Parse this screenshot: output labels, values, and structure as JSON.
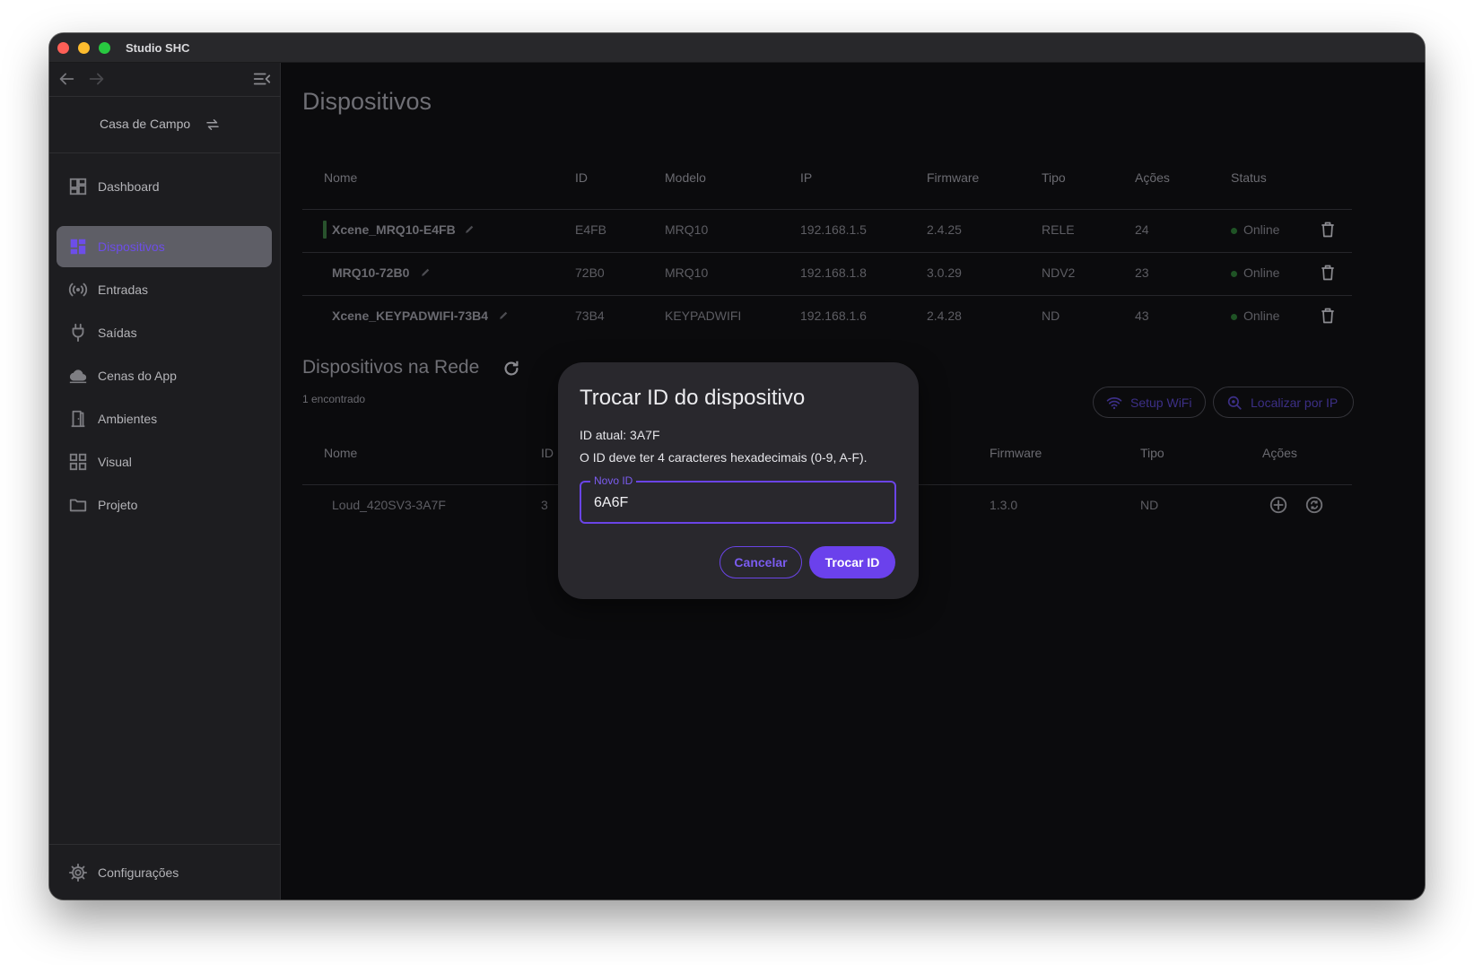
{
  "window": {
    "title": "Studio SHC"
  },
  "sidebar": {
    "project": "Casa de Campo",
    "items": [
      {
        "label": "Dashboard",
        "icon": "dashboard-icon"
      },
      {
        "label": "Dispositivos",
        "icon": "devices-icon",
        "active": true
      },
      {
        "label": "Entradas",
        "icon": "signal-icon"
      },
      {
        "label": "Saídas",
        "icon": "plug-icon"
      },
      {
        "label": "Cenas do App",
        "icon": "cloud-icon"
      },
      {
        "label": "Ambientes",
        "icon": "door-icon"
      },
      {
        "label": "Visual",
        "icon": "grid-icon"
      },
      {
        "label": "Projeto",
        "icon": "folder-icon"
      }
    ],
    "settings_label": "Configurações"
  },
  "main": {
    "title": "Dispositivos",
    "devices_table": {
      "headers": [
        "Nome",
        "ID",
        "Modelo",
        "IP",
        "Firmware",
        "Tipo",
        "Ações",
        "Status"
      ],
      "rows": [
        {
          "name": "Xcene_MRQ10-E4FB",
          "id": "E4FB",
          "model": "MRQ10",
          "ip": "192.168.1.5",
          "firmware": "2.4.25",
          "type": "RELE",
          "actions": "24",
          "status": "Online"
        },
        {
          "name": "MRQ10-72B0",
          "id": "72B0",
          "model": "MRQ10",
          "ip": "192.168.1.8",
          "firmware": "3.0.29",
          "type": "NDV2",
          "actions": "23",
          "status": "Online"
        },
        {
          "name": "Xcene_KEYPADWIFI-73B4",
          "id": "73B4",
          "model": "KEYPADWIFI",
          "ip": "192.168.1.6",
          "firmware": "2.4.28",
          "type": "ND",
          "actions": "43",
          "status": "Online"
        }
      ]
    },
    "network": {
      "title": "Dispositivos na Rede",
      "count_text": "1 encontrado",
      "setup_wifi_label": "Setup WiFi",
      "locate_ip_label": "Localizar por IP",
      "headers": [
        "Nome",
        "ID",
        "Firmware",
        "Tipo",
        "Ações"
      ],
      "rows": [
        {
          "name": "Loud_420SV3-3A7F",
          "id": "3",
          "firmware": "1.3.0",
          "type": "ND"
        }
      ]
    }
  },
  "dialog": {
    "title": "Trocar ID do dispositivo",
    "current_id_text": "ID atual: 3A7F",
    "hint_text": "O ID deve ter 4 caracteres hexadecimais (0-9, A-F).",
    "field_label": "Novo ID",
    "field_value": "6A6F",
    "cancel_label": "Cancelar",
    "confirm_label": "Trocar ID"
  },
  "colors": {
    "accent": "#6b41ec",
    "online_dot": "#1f5325",
    "sidebar_bg": "#1d1d20",
    "main_bg": "#0b0b0d"
  }
}
